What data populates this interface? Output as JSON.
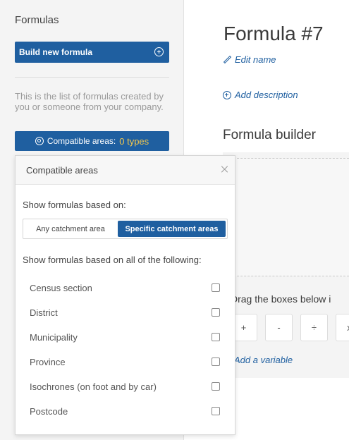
{
  "sidebar": {
    "title": "Formulas",
    "build_button": "Build new formula",
    "description": "This is the list of formulas created by you or someone from your company.",
    "compat_button_label": "Compatible areas:",
    "compat_button_count": "0 types"
  },
  "main": {
    "title": "Formula #7",
    "edit_name": "Edit name",
    "add_description": "Add description",
    "builder_title": "Formula builder",
    "drag_text": "Drag the boxes below i",
    "operators": [
      "+",
      "-",
      "÷",
      "x"
    ],
    "add_variable": "Add a variable"
  },
  "popup": {
    "title": "Compatible areas",
    "show_label": "Show formulas based on:",
    "segment_left": "Any catchment area",
    "segment_right": "Specific catchment areas",
    "all_label": "Show formulas based on all of the following:",
    "options": [
      "Census section",
      "District",
      "Municipality",
      "Province",
      "Isochrones (on foot and by car)",
      "Postcode"
    ]
  }
}
